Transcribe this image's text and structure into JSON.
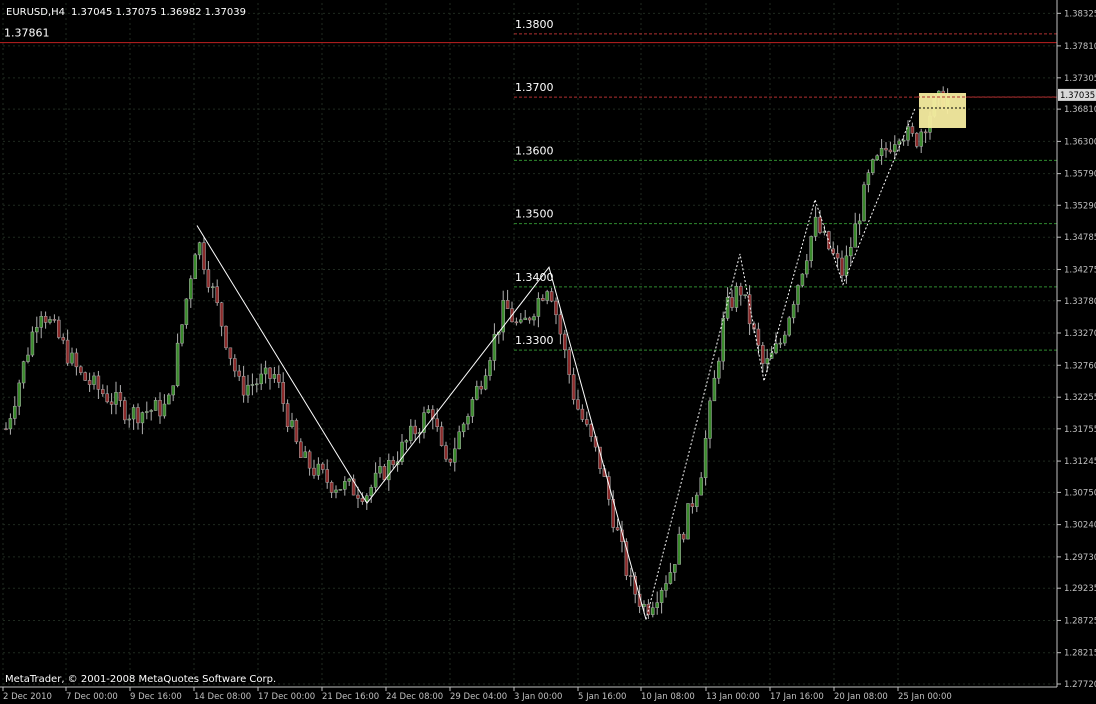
{
  "header": {
    "symbol": "EURUSD,H4",
    "ohlc": "1.37045 1.37075 1.36982 1.37039"
  },
  "footer": {
    "copyright": "MetaTrader, © 2001-2008 MetaQuotes Software Corp."
  },
  "colors": {
    "background": "#000000",
    "axis": "#c0c0c0",
    "grid": "#1f2a1f",
    "bull": "#3a8a2c",
    "bear": "#8a2a2a",
    "wick": "#b0b0b0",
    "resistance": "#c02020",
    "fib_red": "#b03030",
    "fib_green": "#2f8a2f",
    "zigzag": "#ffffff",
    "highlight_box": "#f5eca0",
    "price_tag_bg": "#d8d8d8"
  },
  "price_axis": {
    "ticks": [
      "1.38325",
      "1.37810",
      "1.37305",
      "1.36810",
      "1.36300",
      "1.35790",
      "1.35290",
      "1.34785",
      "1.34275",
      "1.33780",
      "1.33270",
      "1.32760",
      "1.32255",
      "1.31755",
      "1.31245",
      "1.30750",
      "1.30240",
      "1.29730",
      "1.29235",
      "1.28725",
      "1.28215",
      "1.27720"
    ],
    "current_price": "1.37035"
  },
  "time_axis": {
    "ticks": [
      "2 Dec 2010",
      "7 Dec 00:00",
      "9 Dec 16:00",
      "14 Dec 08:00",
      "17 Dec 00:00",
      "21 Dec 16:00",
      "24 Dec 08:00",
      "29 Dec 04:00",
      "3 Jan 00:00",
      "5 Jan 16:00",
      "10 Jan 08:00",
      "13 Jan 00:00",
      "17 Jan 16:00",
      "20 Jan 08:00",
      "25 Jan 00:00"
    ]
  },
  "lines": {
    "resistance": {
      "price": 1.37861,
      "label": "1.37861"
    },
    "fib_levels": [
      {
        "price": 1.38,
        "label": "1.3800",
        "color": "red"
      },
      {
        "price": 1.37,
        "label": "1.3700",
        "color": "red"
      },
      {
        "price": 1.36,
        "label": "1.3600",
        "color": "green"
      },
      {
        "price": 1.35,
        "label": "1.3500",
        "color": "green"
      },
      {
        "price": 1.34,
        "label": "1.3400",
        "color": "green"
      },
      {
        "price": 1.33,
        "label": "1.3300",
        "color": "green"
      }
    ]
  },
  "chart_data": {
    "type": "candlestick",
    "symbol": "EURUSD",
    "timeframe": "H4",
    "ylim": [
      1.2772,
      1.3833
    ],
    "zigzag_solid": [
      {
        "time": "13 Dec 08:00",
        "price": 1.3497
      },
      {
        "time": "22 Dec 20:00",
        "price": 1.3058
      },
      {
        "time": "3 Jan 08:00",
        "price": 1.3431
      },
      {
        "time": "10 Jan 04:00",
        "price": 1.2874
      }
    ],
    "zigzag_dashed": [
      {
        "time": "10 Jan 04:00",
        "price": 1.2874
      },
      {
        "time": "14 Jan 08:00",
        "price": 1.3452
      },
      {
        "time": "17 Jan 00:00",
        "price": 1.3251
      },
      {
        "time": "19 Jan 04:00",
        "price": 1.3538
      },
      {
        "time": "21 Jan 08:00",
        "price": 1.3404
      },
      {
        "time": "25 Jan 08:00",
        "price": 1.3682
      }
    ]
  }
}
